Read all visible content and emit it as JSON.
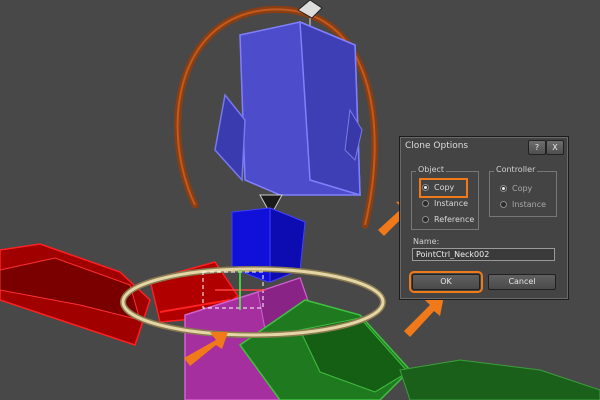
{
  "dialog": {
    "title": "Clone Options",
    "help_label": "?",
    "close_label": "X",
    "object_group": {
      "label": "Object",
      "options": [
        {
          "label": "Copy",
          "selected": true
        },
        {
          "label": "Instance",
          "selected": false
        },
        {
          "label": "Reference",
          "selected": false
        }
      ]
    },
    "controller_group": {
      "label": "Controller",
      "options": [
        {
          "label": "Copy",
          "selected": true
        },
        {
          "label": "Instance",
          "selected": false
        }
      ]
    },
    "name_label": "Name:",
    "name_value": "PointCtrl_Neck002",
    "ok_label": "OK",
    "cancel_label": "Cancel"
  },
  "colors": {
    "viewport_bg": "#484848",
    "highlight": "#f07a1a",
    "arrow": "#f07a1a"
  }
}
